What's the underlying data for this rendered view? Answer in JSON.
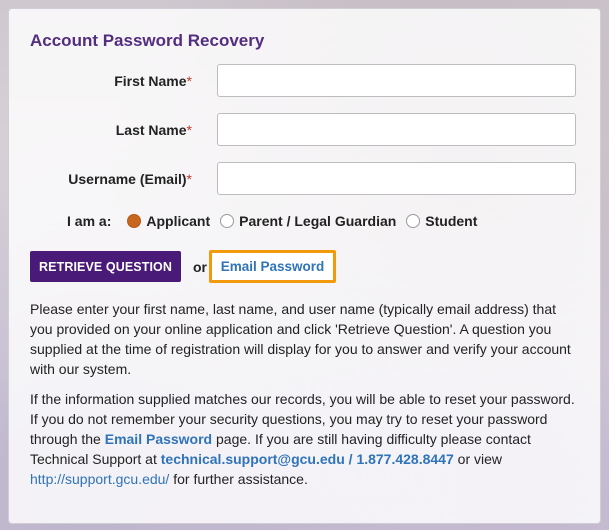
{
  "form": {
    "title": "Account Password Recovery",
    "fields": [
      {
        "label": "First Name",
        "required_mark": "*",
        "value": ""
      },
      {
        "label": "Last Name",
        "required_mark": "*",
        "value": ""
      },
      {
        "label": "Username (Email)",
        "required_mark": "*",
        "value": ""
      }
    ],
    "role": {
      "label": "I am a:",
      "options": [
        {
          "label": "Applicant",
          "checked": true
        },
        {
          "label": "Parent / Legal Guardian",
          "checked": false
        },
        {
          "label": "Student",
          "checked": false
        }
      ]
    },
    "actions": {
      "retrieve_label": "Retrieve Question",
      "or_text": "or",
      "email_password_label": "Email Password"
    }
  },
  "instructions": {
    "p1": "Please enter your first name, last name, and user name (typically email address) that you provided on your online application and click 'Retrieve Question'. A question you supplied at the time of registration will display for you to answer and verify your account with our system.",
    "p2_a": "If the information supplied matches our records, you will be able to reset your password. If you do not remember your security questions, you may try to reset your password through the ",
    "p2_link": "Email Password",
    "p2_b": " page. If you are still having difficulty please contact Technical Support at ",
    "p2_email": "technical.support@gcu.edu",
    "p2_sep": " / ",
    "p2_phone": "1.877.428.8447",
    "p2_c": " or view ",
    "p2_url": "http://support.gcu.edu/",
    "p2_d": " for further assistance."
  },
  "colors": {
    "title": "#522d80",
    "button_bg": "#4a1a78",
    "highlight_border": "#f29a0c",
    "link": "#2f73b8",
    "radio_checked": "#c8661e"
  }
}
